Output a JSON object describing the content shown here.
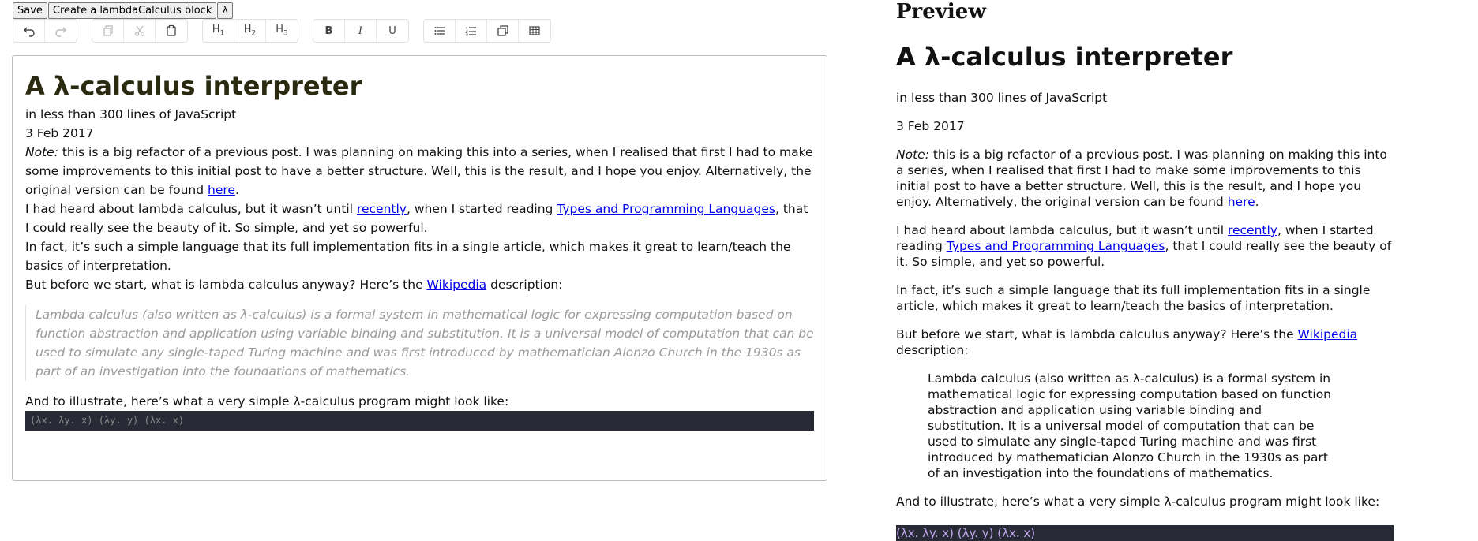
{
  "top_buttons": {
    "save": "Save",
    "create_block": "Create a lambdaCalculus block",
    "lambda": "λ"
  },
  "toolbar": {
    "h1": "H",
    "h1_sub": "1",
    "h2": "H",
    "h2_sub": "2",
    "h3": "H",
    "h3_sub": "3",
    "bold": "B",
    "italic": "I",
    "underline": "U"
  },
  "doc": {
    "title": "A λ-calculus interpreter",
    "subtitle": "in less than 300 lines of JavaScript",
    "date": "3 Feb 2017",
    "note_label": "Note:",
    "note_text": " this is a big refactor of a previous post. I was planning on making this into a series, when I realised that first I had to make some improvements to this initial post to have a better structure. Well, this is the result, and I hope you enjoy. Alternatively, the original version can be found ",
    "note_link": "here",
    "note_end": ".",
    "p2_a": "I had heard about lambda calculus, but it wasn’t until ",
    "p2_link1": "recently",
    "p2_b": ", when I started reading ",
    "p2_link2": "Types and Programming Languages",
    "p2_c": ", that I could really see the beauty of it. So simple, and yet so powerful.",
    "p3": "In fact, it’s such a simple language that its full implementation fits in a single article, which makes it great to learn/teach the basics of interpretation.",
    "p4_a": "But before we start, what is lambda calculus anyway? Here’s the ",
    "p4_link": "Wikipedia",
    "p4_b": " description:",
    "quote": "Lambda calculus (also written as λ-calculus) is a formal system in mathematical logic for expressing computation based on function abstraction and application using variable binding and substitution. It is a universal model of computation that can be used to simulate any single-taped Turing machine and was first introduced by mathematician Alonzo Church in the 1930s as part of an investigation into the foundations of mathematics.",
    "p5": "And to illustrate, here’s what a very simple λ-calculus program might look like:",
    "code": "(λx. λy. x) (λy. y) (λx. x)"
  },
  "preview": {
    "heading": "Preview"
  }
}
